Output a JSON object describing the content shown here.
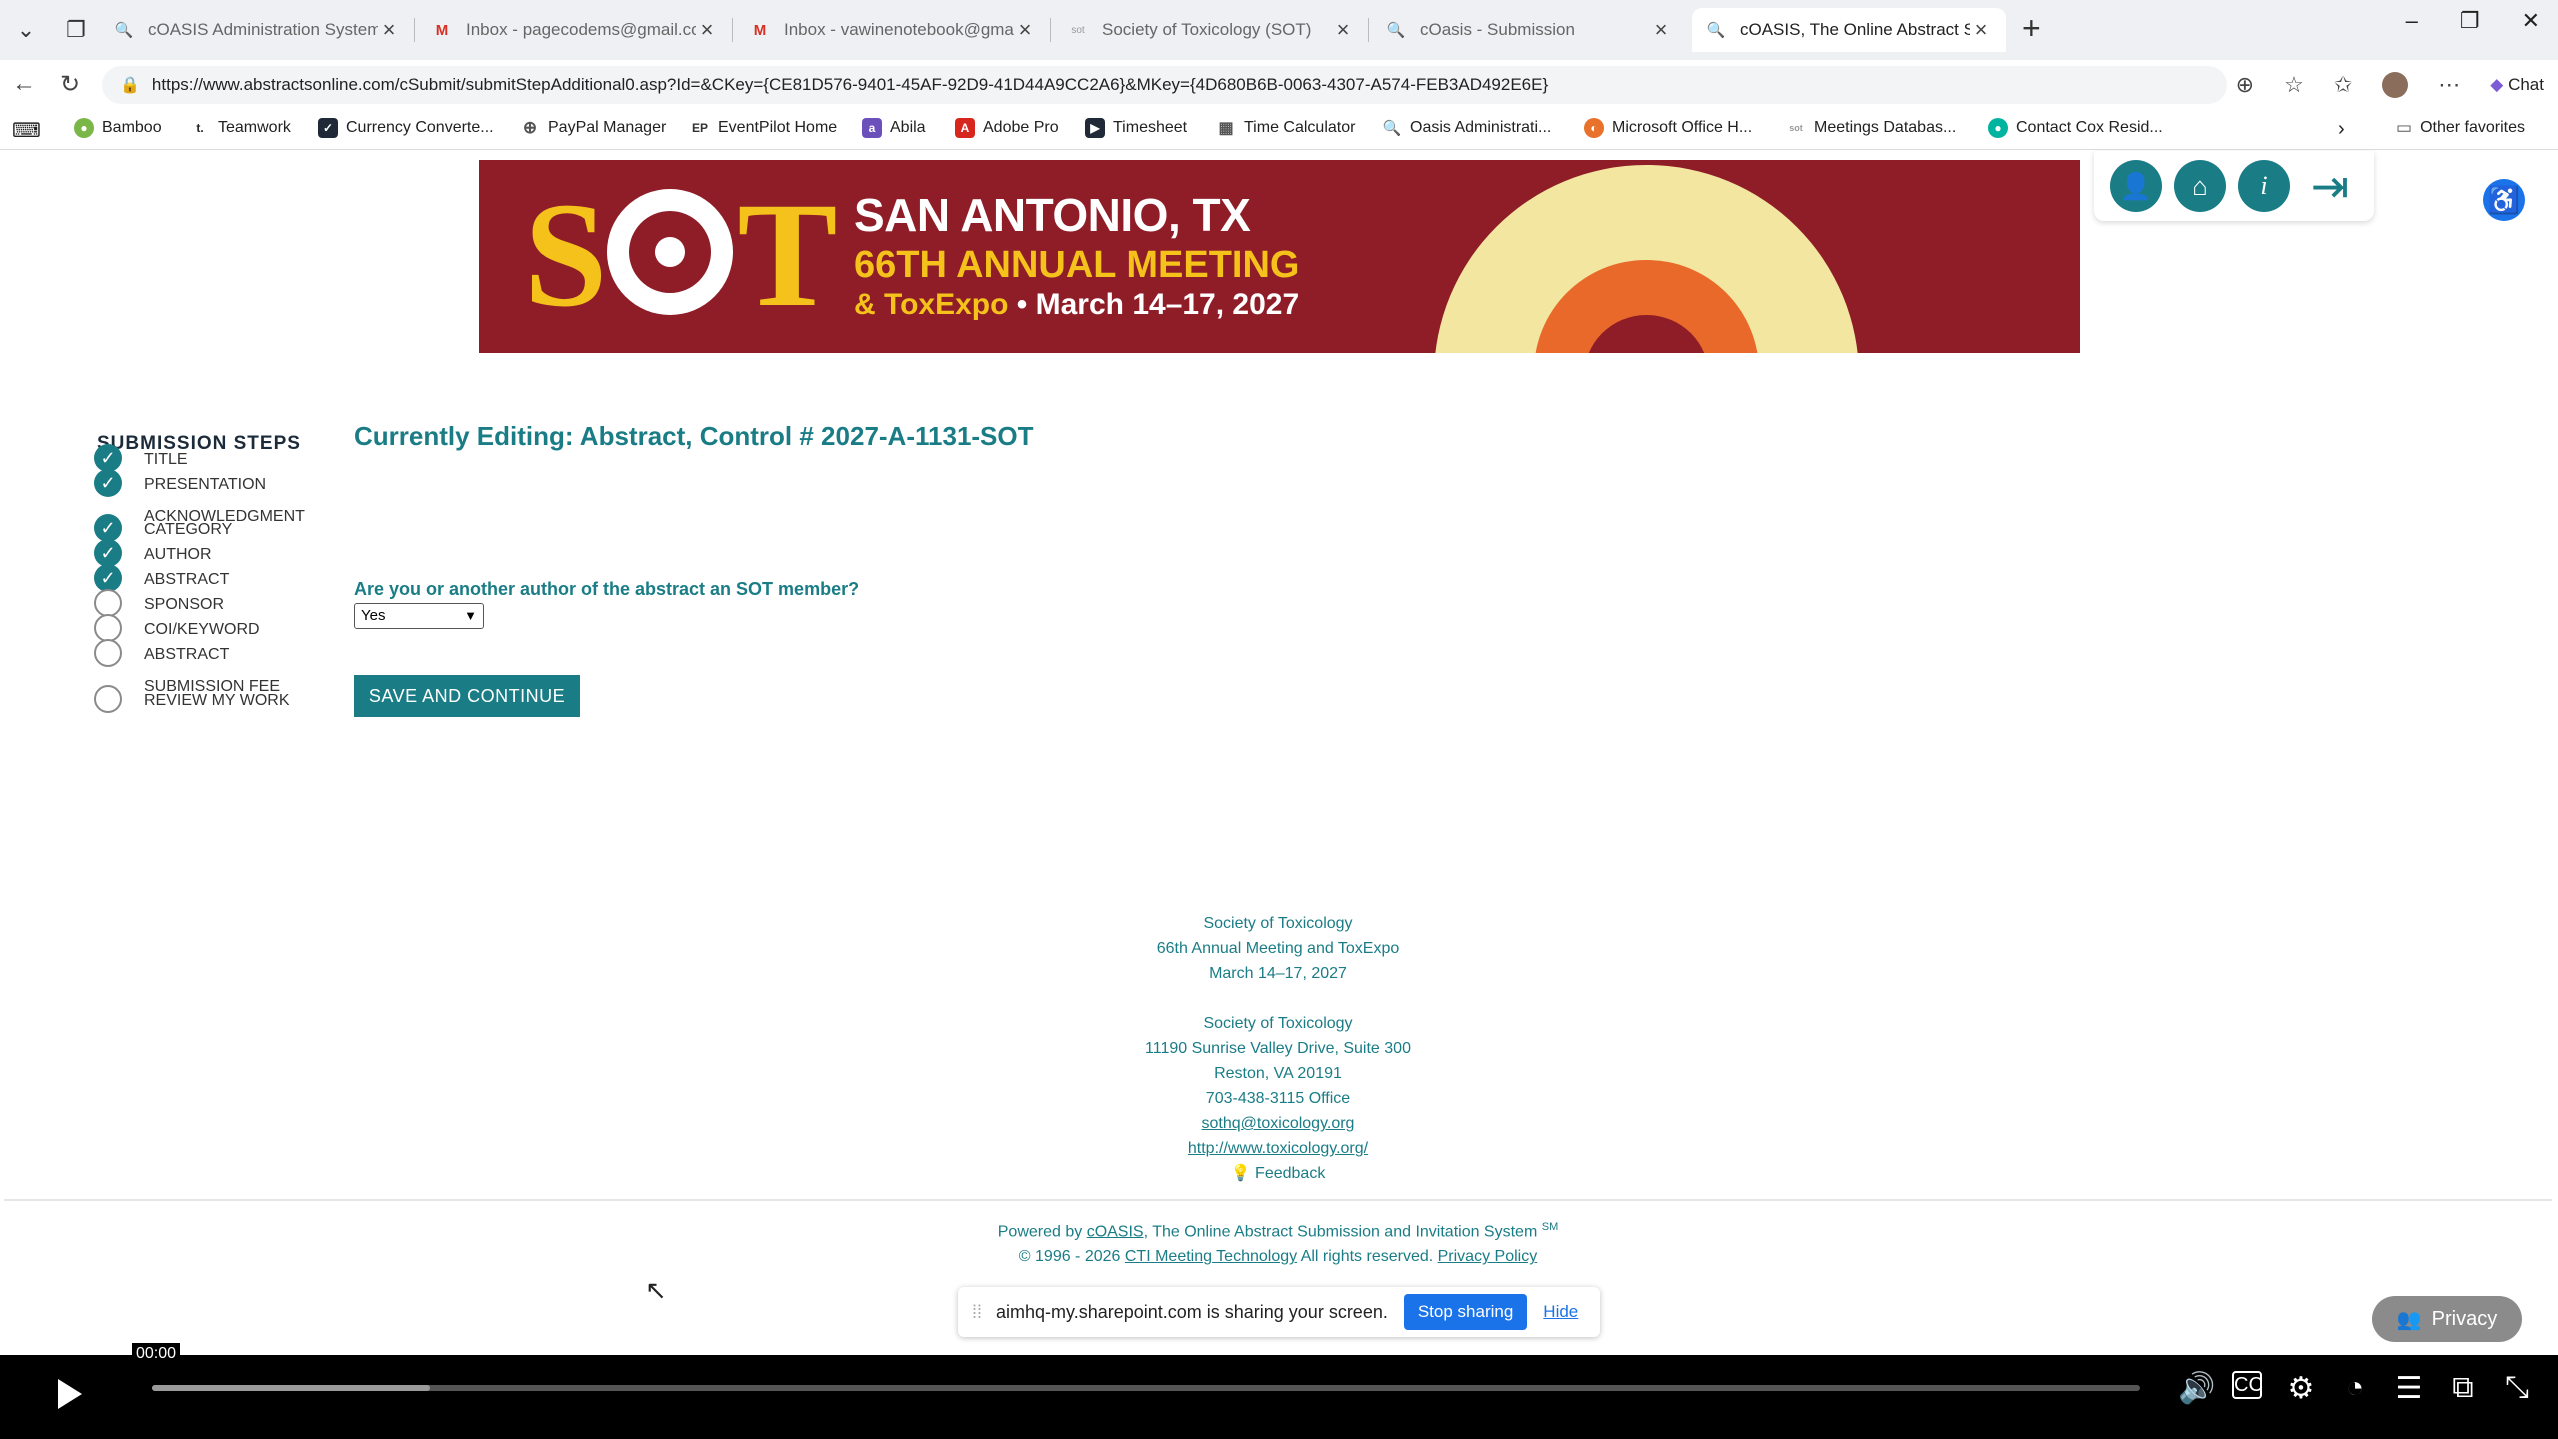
{
  "browser": {
    "tabs": [
      {
        "title": "cOASIS Administration System",
        "icon": "coasis-tab-icon"
      },
      {
        "title": "Inbox - pagecodems@gmail.com",
        "icon": "gmail-tab-icon"
      },
      {
        "title": "Inbox - vawinenotebook@gmail.c",
        "icon": "gmail-tab-icon"
      },
      {
        "title": "Society of Toxicology (SOT)",
        "icon": "sot-tab-icon"
      },
      {
        "title": "cOasis - Submission",
        "icon": "coasis-tab-icon"
      },
      {
        "title": "cOASIS, The Online Abstract Subm",
        "icon": "coasis-tab-icon"
      }
    ],
    "active_tab": 5,
    "url": "https://www.abstractsonline.com/cSubmit/submitStepAdditional0.asp?Id=&CKey={CE81D576-9401-45AF-92D9-41D44A9CC2A6}&MKey={4D680B6B-0063-4307-A574-FEB3AD492E6E}",
    "chat_label": "Chat",
    "bookmarks": [
      "Bamboo",
      "Teamwork",
      "Currency Converte...",
      "PayPal Manager",
      "EventPilot Home",
      "Abila",
      "Adobe Pro",
      "Timesheet",
      "Time Calculator",
      "Oasis Administrati...",
      "Microsoft Office H...",
      "Meetings Databas...",
      "Contact Cox Resid..."
    ],
    "other_favorites": "Other favorites"
  },
  "banner": {
    "logo": "SOT",
    "location": "SAN ANTONIO, TX",
    "meeting": "66TH ANNUAL MEETING",
    "expo_prefix": "& ToxExpo",
    "expo_dates": " • March 14–17, 2027"
  },
  "sidebar": {
    "title": "SUBMISSION STEPS",
    "steps": [
      {
        "label": "TITLE",
        "done": true
      },
      {
        "label": "PRESENTATION ACKNOWLEDGMENT",
        "done": true
      },
      {
        "label": "CATEGORY",
        "done": true
      },
      {
        "label": "AUTHOR",
        "done": true
      },
      {
        "label": "ABSTRACT",
        "done": true
      },
      {
        "label": "SPONSOR",
        "done": false
      },
      {
        "label": "COI/KEYWORD",
        "done": false
      },
      {
        "label": "ABSTRACT SUBMISSION FEE",
        "done": false
      },
      {
        "label": "REVIEW MY WORK",
        "done": false
      }
    ]
  },
  "main": {
    "editing_title": "Currently Editing: Abstract,  Control # 2027-A-1131-SOT",
    "question": "Are you or another author of the abstract an SOT member?",
    "select_value": "Yes",
    "save_button": "SAVE AND CONTINUE"
  },
  "footer": {
    "org1": "Society of Toxicology",
    "event": "66th Annual Meeting and ToxExpo",
    "dates": "March 14–17, 2027",
    "org2": "Society of Toxicology",
    "address1": "11190 Sunrise Valley Drive, Suite 300",
    "address2": "Reston, VA 20191",
    "phone": "703-438-3115 Office",
    "email": "sothq@toxicology.org",
    "website": "http://www.toxicology.org/",
    "feedback": "Feedback"
  },
  "powered": {
    "prefix": "Powered by ",
    "coasis": "cOASIS",
    "suffix": ", The Online Abstract Submission and Invitation System",
    "sm": "SM",
    "copyright": "© 1996 - 2026 ",
    "cti": "CTI Meeting Technology",
    "rights": "  All rights reserved. ",
    "privacy": "Privacy Policy"
  },
  "share_bar": {
    "message": "aimhq-my.sharepoint.com is sharing your screen.",
    "stop": "Stop sharing",
    "hide": "Hide"
  },
  "privacy_button": "Privacy",
  "player": {
    "time": "00:00",
    "buffered_fraction": 0.14
  }
}
